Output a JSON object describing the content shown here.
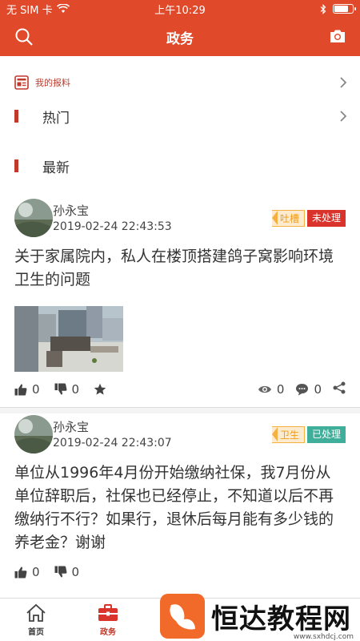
{
  "status_bar": {
    "carrier": "无 SIM 卡",
    "time": "上午10:29",
    "battery_level": 0.8
  },
  "nav": {
    "title": "政务",
    "left_icon": "search-icon",
    "right_icon": "camera-icon"
  },
  "my_report": {
    "label": "我的报料"
  },
  "sections": [
    {
      "label": "热门"
    },
    {
      "label": "最新"
    }
  ],
  "posts": [
    {
      "author": "孙永宝",
      "time": "2019-02-24 22:43:53",
      "tags": [
        {
          "text": "吐槽",
          "color": "#f39c12"
        },
        {
          "text": "未处理",
          "color": "#d9332b"
        }
      ],
      "title": "关于家属院内，私人在楼顶搭建鸽子窝影响环境卫生的问题",
      "likes": "0",
      "dislikes": "0",
      "views": "0",
      "comments": "0"
    },
    {
      "author": "孙永宝",
      "time": "2019-02-24 22:43:07",
      "tags": [
        {
          "text": "卫生",
          "color": "#f39c12"
        },
        {
          "text": "已处理",
          "color": "#3fae9a"
        }
      ],
      "title": "单位从1996年4月份开始缴纳社保，我7月份从单位辞职后，社保也已经停止，不知道以后不再缴纳行不行？如果行，退休后每月能有多少钱的养老金？谢谢",
      "likes": "0",
      "dislikes": "0"
    }
  ],
  "tab_bar": [
    {
      "label": "首页",
      "icon": "home-icon"
    },
    {
      "label": "政务",
      "icon": "briefcase-icon"
    }
  ],
  "watermark": {
    "text": "恒达教程网",
    "url": "www.sxhdcj.com"
  },
  "colors": {
    "brand": "#e04a2b",
    "accent_red": "#c0392b"
  }
}
